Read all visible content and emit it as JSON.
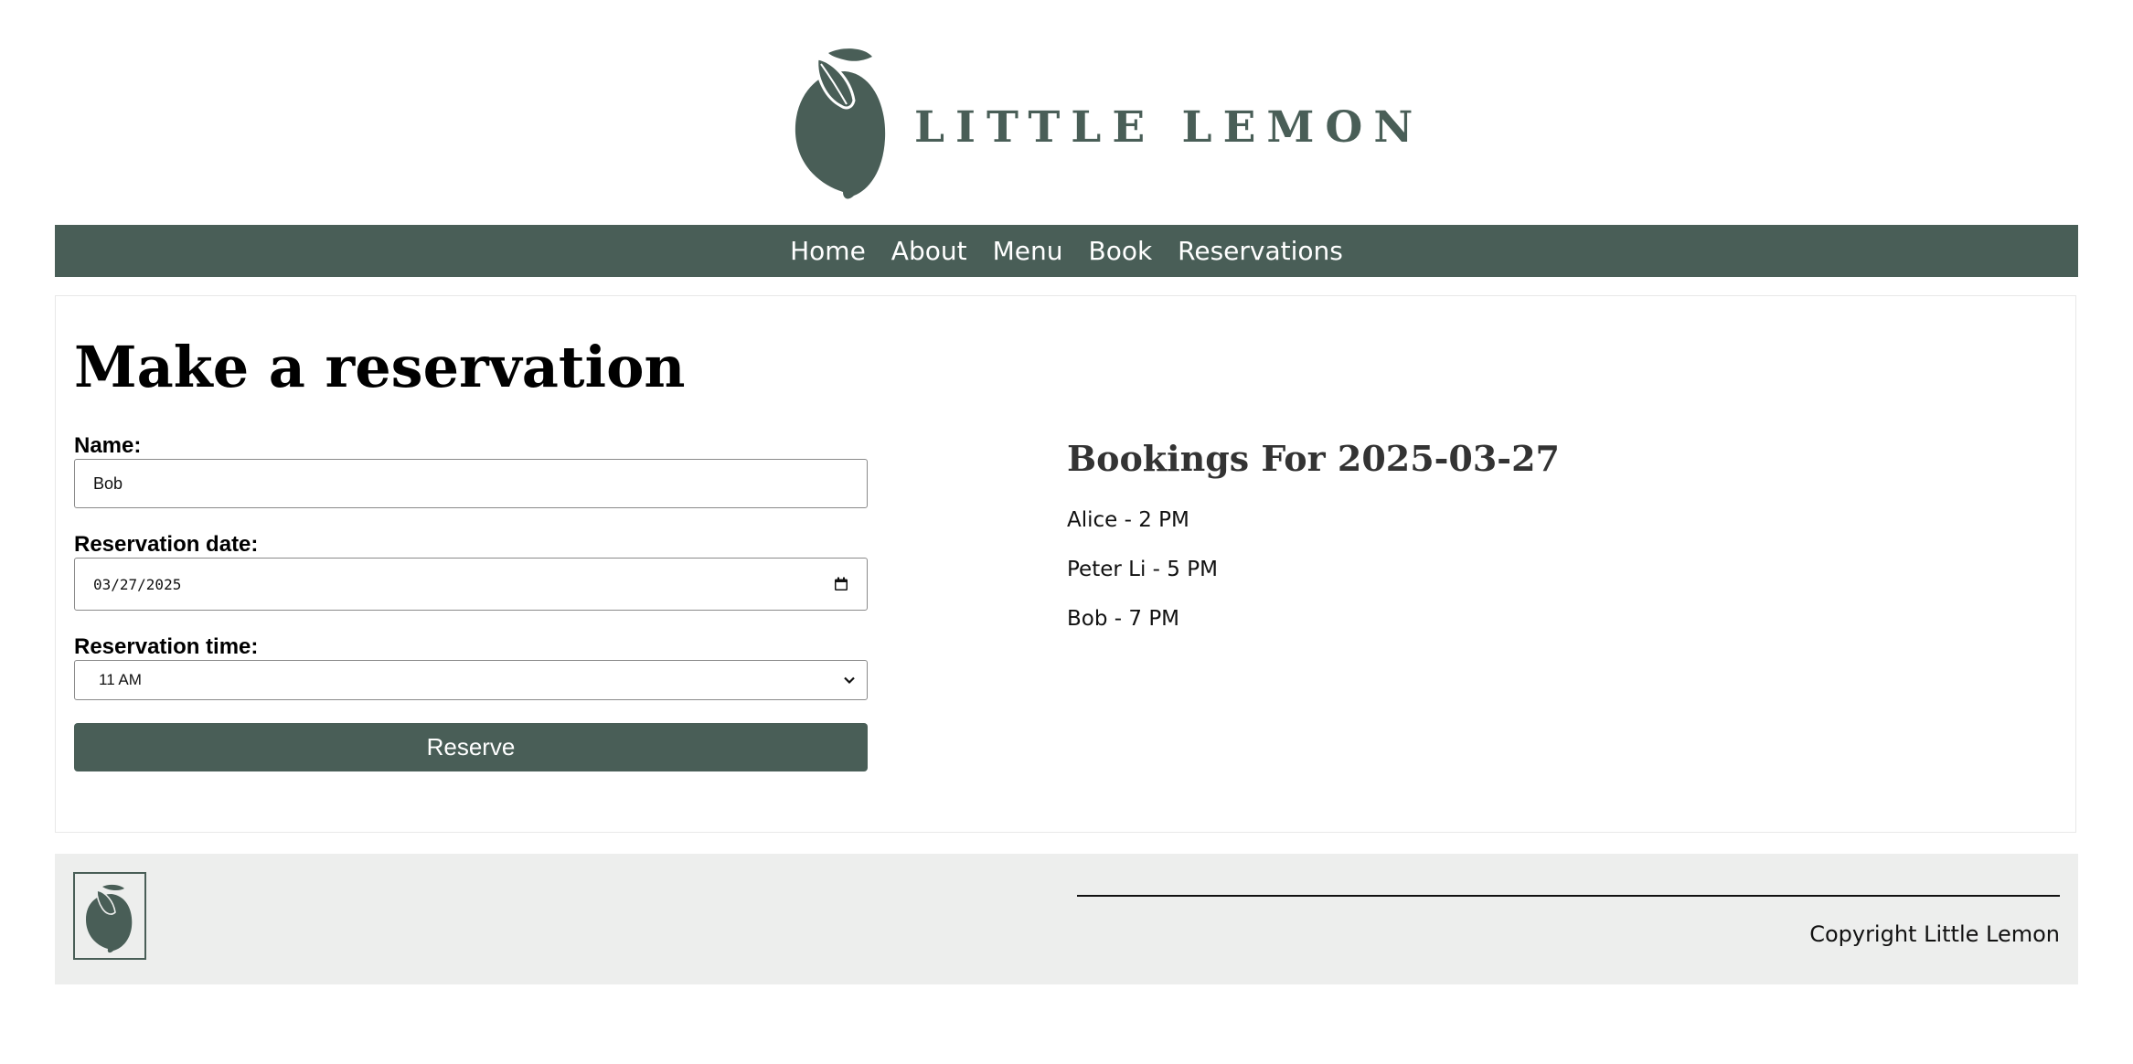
{
  "brand": {
    "name": "LITTLE LEMON",
    "color": "#495e57"
  },
  "nav": {
    "items": [
      "Home",
      "About",
      "Menu",
      "Book",
      "Reservations"
    ]
  },
  "reservation": {
    "title": "Make a reservation",
    "name_label": "Name:",
    "name_value": "Bob",
    "date_label": "Reservation date:",
    "date_value": "03/27/2025",
    "time_label": "Reservation time:",
    "time_value": "11 AM",
    "submit_label": "Reserve"
  },
  "bookings": {
    "title": "Bookings For 2025-03-27",
    "items": [
      "Alice - 2 PM",
      "Peter Li - 5 PM",
      "Bob - 7 PM"
    ]
  },
  "footer": {
    "copyright": "Copyright Little Lemon",
    "background": "#edeeed"
  },
  "icons": {
    "logo": "lemon-icon",
    "date": "calendar-icon",
    "select": "chevron-down-icon"
  }
}
